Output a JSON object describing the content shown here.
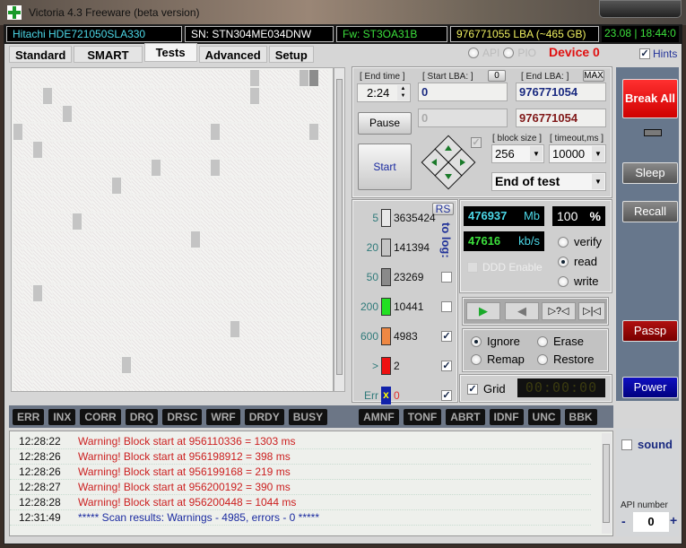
{
  "window": {
    "title": "Victoria 4.3 Freeware (beta version)"
  },
  "info": {
    "model": "Hitachi HDE721050SLA330",
    "serial": "SN: STN304ME034DNW",
    "firmware": "Fw: ST3OA31B",
    "capacity": "976771055 LBA (~465 GB)",
    "datetime": "23.08 | 18:44:0"
  },
  "tabs": [
    "Standard",
    "SMART",
    "Tests",
    "Advanced",
    "Setup"
  ],
  "active_tab": "Tests",
  "mode": {
    "api": "API",
    "pio": "PIO",
    "device": "Device 0",
    "hints": "Hints"
  },
  "controls": {
    "end_time_label": "[ End time ]",
    "end_time": "2:24",
    "start_lba_label": "[ Start LBA: ]",
    "start_zero_btn": "0",
    "start_lba": "0",
    "start_lba_current": "0",
    "end_lba_label": "[ End LBA: ]",
    "max_btn": "MAX",
    "end_lba": "976771054",
    "end_lba_current": "976771054",
    "pause": "Pause",
    "start": "Start",
    "block_size_label": "[ block size ]",
    "block_size": "256",
    "timeout_label": "[ timeout,ms ]",
    "timeout": "10000",
    "end_action": "End of test"
  },
  "stats": {
    "rs": "RS",
    "to_log": "to log:",
    "rows": [
      {
        "threshold": "5",
        "count": "3635424",
        "color": "#e8e8e8",
        "log": null
      },
      {
        "threshold": "20",
        "count": "141394",
        "color": "#c4c4c4",
        "log": null
      },
      {
        "threshold": "50",
        "count": "23269",
        "color": "#8a8a8a",
        "log": false
      },
      {
        "threshold": "200",
        "count": "10441",
        "color": "#22e022",
        "log": false
      },
      {
        "threshold": "600",
        "count": "4983",
        "color": "#ee8844",
        "log": true
      },
      {
        "threshold": ">",
        "count": "2",
        "color": "#ee1111",
        "log": true
      },
      {
        "threshold": "Err",
        "count": "0",
        "color": "#1122aa",
        "log": true
      }
    ]
  },
  "progress": {
    "mb": "476937",
    "mb_unit": "Mb",
    "percent": "100",
    "percent_unit": "%",
    "speed": "47616",
    "speed_unit": "kb/s",
    "ddd": "DDD Enable"
  },
  "scan_mode": {
    "options": [
      "verify",
      "read",
      "write"
    ],
    "selected": "read"
  },
  "nav": {
    "play": "▶",
    "back": "◀",
    "random": "▷?◁",
    "end": "▷|◁"
  },
  "repair": {
    "options": [
      "Ignore",
      "Erase",
      "Remap",
      "Restore"
    ],
    "selected": "Ignore"
  },
  "grid_label": "Grid",
  "timer": "00:00:00",
  "sidebar": {
    "break_all": "Break All",
    "sleep": "Sleep",
    "recall": "Recall",
    "passp": "Passp",
    "power": "Power"
  },
  "flags": [
    "ERR",
    "INX",
    "CORR",
    "DRQ",
    "DRSC",
    "WRF",
    "DRDY",
    "BUSY",
    "AMNF",
    "TONF",
    "ABRT",
    "IDNF",
    "UNC",
    "BBK"
  ],
  "log": [
    {
      "time": "12:28:22",
      "msg": "Warning! Block start at 956110336 = 1303 ms",
      "type": "warn"
    },
    {
      "time": "12:28:26",
      "msg": "Warning! Block start at 956198912 = 398 ms",
      "type": "warn"
    },
    {
      "time": "12:28:26",
      "msg": "Warning! Block start at 956199168 = 219 ms",
      "type": "warn"
    },
    {
      "time": "12:28:27",
      "msg": "Warning! Block start at 956200192 = 390 ms",
      "type": "warn"
    },
    {
      "time": "12:28:28",
      "msg": "Warning! Block start at 956200448 = 1044 ms",
      "type": "warn"
    },
    {
      "time": "12:31:49",
      "msg": "***** Scan results: Warnings - 4985, errors - 0 *****",
      "type": "info"
    }
  ],
  "bottom": {
    "sound": "sound",
    "api_number_label": "API number",
    "api_number": "0",
    "minus": "-",
    "plus": "+"
  }
}
